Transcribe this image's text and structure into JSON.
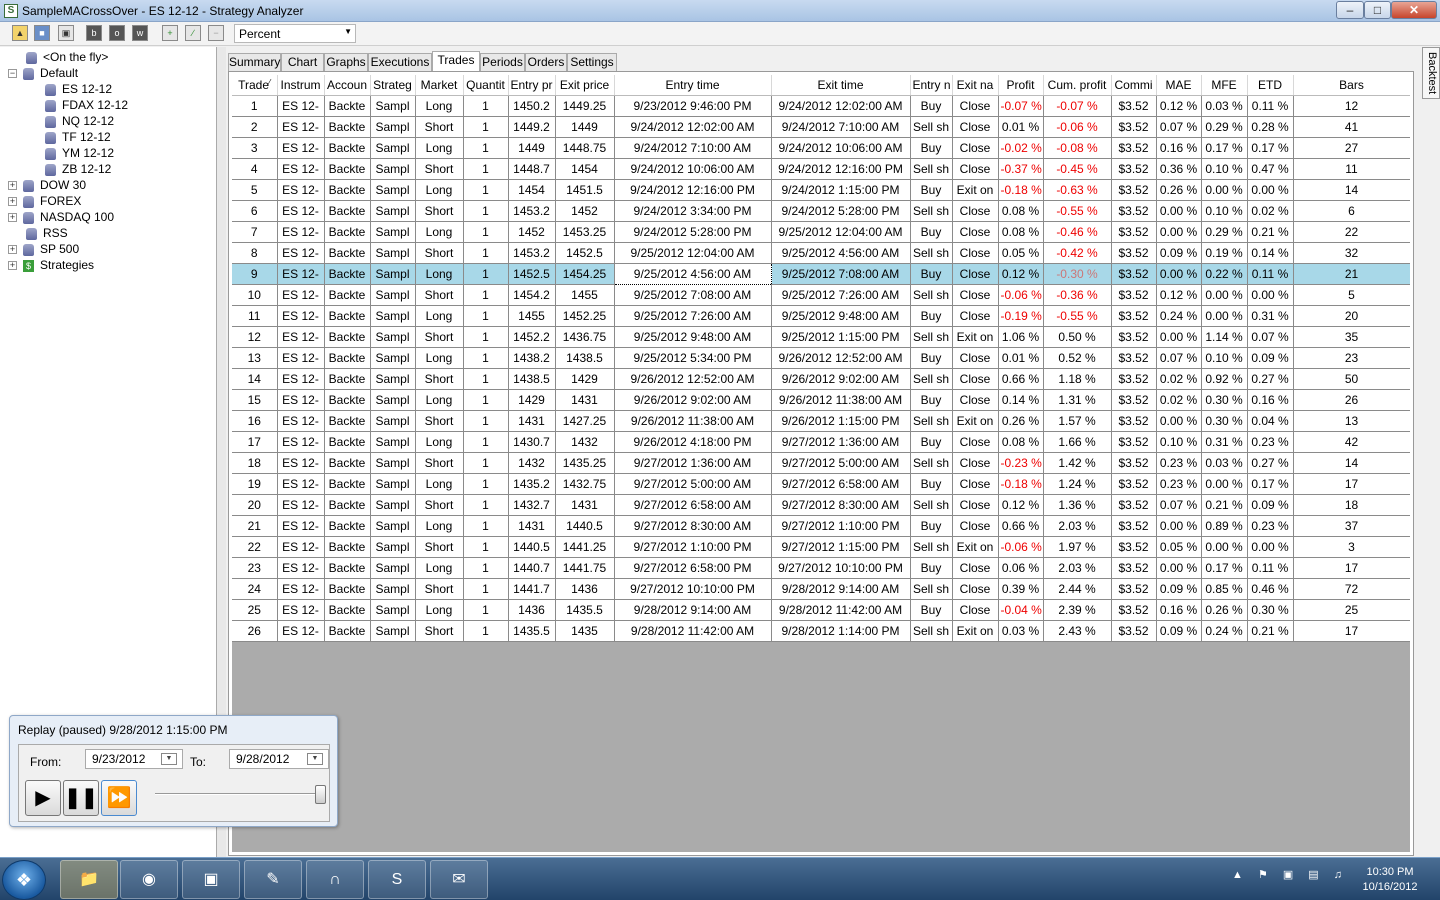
{
  "window": {
    "title": "SampleMACrossOver - ES 12-12 - Strategy Analyzer",
    "app_icon": "S"
  },
  "toolbar": {
    "percent_value": "Percent",
    "btn_b": "b",
    "btn_o": "o",
    "btn_w": "w"
  },
  "tree": {
    "on_the_fly": "<On the fly>",
    "default": "Default",
    "default_children": [
      "ES 12-12",
      "FDAX 12-12",
      "NQ 12-12",
      "TF 12-12",
      "YM 12-12",
      "ZB 12-12"
    ],
    "dow30": "DOW 30",
    "forex": "FOREX",
    "nasdaq": "NASDAQ 100",
    "rss": "RSS",
    "sp500": "SP 500",
    "strategies": "Strategies"
  },
  "tabs": [
    "Summary",
    "Chart",
    "Graphs",
    "Executions",
    "Trades",
    "Periods",
    "Orders",
    "Settings"
  ],
  "right_tab": "Backtest",
  "columns": [
    "Trade",
    "Instrum",
    "Accoun",
    "Strateg",
    "Market",
    "Quantit",
    "Entry pr",
    "Exit price",
    "Entry time",
    "Exit time",
    "Entry n",
    "Exit na",
    "Profit",
    "Cum. profit",
    "Commi",
    "MAE",
    "MFE",
    "ETD",
    "Bars"
  ],
  "sort_indicator": "⁄",
  "trades": [
    [
      "1",
      "ES 12-",
      "Backte",
      "Sampl",
      "Long",
      "1",
      "1450.2",
      "1449.25",
      "9/23/2012 9:46:00 PM",
      "9/24/2012 12:02:00 AM",
      "Buy",
      "Close",
      "-0.07 %",
      "-0.07 %",
      "$3.52",
      "0.12 %",
      "0.03 %",
      "0.11 %",
      "12"
    ],
    [
      "2",
      "ES 12-",
      "Backte",
      "Sampl",
      "Short",
      "1",
      "1449.2",
      "1449",
      "9/24/2012 12:02:00 AM",
      "9/24/2012 7:10:00 AM",
      "Sell sh",
      "Close",
      "0.01 %",
      "-0.06 %",
      "$3.52",
      "0.07 %",
      "0.29 %",
      "0.28 %",
      "41"
    ],
    [
      "3",
      "ES 12-",
      "Backte",
      "Sampl",
      "Long",
      "1",
      "1449",
      "1448.75",
      "9/24/2012 7:10:00 AM",
      "9/24/2012 10:06:00 AM",
      "Buy",
      "Close",
      "-0.02 %",
      "-0.08 %",
      "$3.52",
      "0.16 %",
      "0.17 %",
      "0.17 %",
      "27"
    ],
    [
      "4",
      "ES 12-",
      "Backte",
      "Sampl",
      "Short",
      "1",
      "1448.7",
      "1454",
      "9/24/2012 10:06:00 AM",
      "9/24/2012 12:16:00 PM",
      "Sell sh",
      "Close",
      "-0.37 %",
      "-0.45 %",
      "$3.52",
      "0.36 %",
      "0.10 %",
      "0.47 %",
      "11"
    ],
    [
      "5",
      "ES 12-",
      "Backte",
      "Sampl",
      "Long",
      "1",
      "1454",
      "1451.5",
      "9/24/2012 12:16:00 PM",
      "9/24/2012 1:15:00 PM",
      "Buy",
      "Exit on",
      "-0.18 %",
      "-0.63 %",
      "$3.52",
      "0.26 %",
      "0.00 %",
      "0.00 %",
      "14"
    ],
    [
      "6",
      "ES 12-",
      "Backte",
      "Sampl",
      "Short",
      "1",
      "1453.2",
      "1452",
      "9/24/2012 3:34:00 PM",
      "9/24/2012 5:28:00 PM",
      "Sell sh",
      "Close",
      "0.08 %",
      "-0.55 %",
      "$3.52",
      "0.00 %",
      "0.10 %",
      "0.02 %",
      "6"
    ],
    [
      "7",
      "ES 12-",
      "Backte",
      "Sampl",
      "Long",
      "1",
      "1452",
      "1453.25",
      "9/24/2012 5:28:00 PM",
      "9/25/2012 12:04:00 AM",
      "Buy",
      "Close",
      "0.08 %",
      "-0.46 %",
      "$3.52",
      "0.00 %",
      "0.29 %",
      "0.21 %",
      "22"
    ],
    [
      "8",
      "ES 12-",
      "Backte",
      "Sampl",
      "Short",
      "1",
      "1453.2",
      "1452.5",
      "9/25/2012 12:04:00 AM",
      "9/25/2012 4:56:00 AM",
      "Sell sh",
      "Close",
      "0.05 %",
      "-0.42 %",
      "$3.52",
      "0.09 %",
      "0.19 %",
      "0.14 %",
      "32"
    ],
    [
      "9",
      "ES 12-",
      "Backte",
      "Sampl",
      "Long",
      "1",
      "1452.5",
      "1454.25",
      "9/25/2012 4:56:00 AM",
      "9/25/2012 7:08:00 AM",
      "Buy",
      "Close",
      "0.12 %",
      "-0.30 %",
      "$3.52",
      "0.00 %",
      "0.22 %",
      "0.11 %",
      "21"
    ],
    [
      "10",
      "ES 12-",
      "Backte",
      "Sampl",
      "Short",
      "1",
      "1454.2",
      "1455",
      "9/25/2012 7:08:00 AM",
      "9/25/2012 7:26:00 AM",
      "Sell sh",
      "Close",
      "-0.06 %",
      "-0.36 %",
      "$3.52",
      "0.12 %",
      "0.00 %",
      "0.00 %",
      "5"
    ],
    [
      "11",
      "ES 12-",
      "Backte",
      "Sampl",
      "Long",
      "1",
      "1455",
      "1452.25",
      "9/25/2012 7:26:00 AM",
      "9/25/2012 9:48:00 AM",
      "Buy",
      "Close",
      "-0.19 %",
      "-0.55 %",
      "$3.52",
      "0.24 %",
      "0.00 %",
      "0.31 %",
      "20"
    ],
    [
      "12",
      "ES 12-",
      "Backte",
      "Sampl",
      "Short",
      "1",
      "1452.2",
      "1436.75",
      "9/25/2012 9:48:00 AM",
      "9/25/2012 1:15:00 PM",
      "Sell sh",
      "Exit on",
      "1.06 %",
      "0.50 %",
      "$3.52",
      "0.00 %",
      "1.14 %",
      "0.07 %",
      "35"
    ],
    [
      "13",
      "ES 12-",
      "Backte",
      "Sampl",
      "Long",
      "1",
      "1438.2",
      "1438.5",
      "9/25/2012 5:34:00 PM",
      "9/26/2012 12:52:00 AM",
      "Buy",
      "Close",
      "0.01 %",
      "0.52 %",
      "$3.52",
      "0.07 %",
      "0.10 %",
      "0.09 %",
      "23"
    ],
    [
      "14",
      "ES 12-",
      "Backte",
      "Sampl",
      "Short",
      "1",
      "1438.5",
      "1429",
      "9/26/2012 12:52:00 AM",
      "9/26/2012 9:02:00 AM",
      "Sell sh",
      "Close",
      "0.66 %",
      "1.18 %",
      "$3.52",
      "0.02 %",
      "0.92 %",
      "0.27 %",
      "50"
    ],
    [
      "15",
      "ES 12-",
      "Backte",
      "Sampl",
      "Long",
      "1",
      "1429",
      "1431",
      "9/26/2012 9:02:00 AM",
      "9/26/2012 11:38:00 AM",
      "Buy",
      "Close",
      "0.14 %",
      "1.31 %",
      "$3.52",
      "0.02 %",
      "0.30 %",
      "0.16 %",
      "26"
    ],
    [
      "16",
      "ES 12-",
      "Backte",
      "Sampl",
      "Short",
      "1",
      "1431",
      "1427.25",
      "9/26/2012 11:38:00 AM",
      "9/26/2012 1:15:00 PM",
      "Sell sh",
      "Exit on",
      "0.26 %",
      "1.57 %",
      "$3.52",
      "0.00 %",
      "0.30 %",
      "0.04 %",
      "13"
    ],
    [
      "17",
      "ES 12-",
      "Backte",
      "Sampl",
      "Long",
      "1",
      "1430.7",
      "1432",
      "9/26/2012 4:18:00 PM",
      "9/27/2012 1:36:00 AM",
      "Buy",
      "Close",
      "0.08 %",
      "1.66 %",
      "$3.52",
      "0.10 %",
      "0.31 %",
      "0.23 %",
      "42"
    ],
    [
      "18",
      "ES 12-",
      "Backte",
      "Sampl",
      "Short",
      "1",
      "1432",
      "1435.25",
      "9/27/2012 1:36:00 AM",
      "9/27/2012 5:00:00 AM",
      "Sell sh",
      "Close",
      "-0.23 %",
      "1.42 %",
      "$3.52",
      "0.23 %",
      "0.03 %",
      "0.27 %",
      "14"
    ],
    [
      "19",
      "ES 12-",
      "Backte",
      "Sampl",
      "Long",
      "1",
      "1435.2",
      "1432.75",
      "9/27/2012 5:00:00 AM",
      "9/27/2012 6:58:00 AM",
      "Buy",
      "Close",
      "-0.18 %",
      "1.24 %",
      "$3.52",
      "0.23 %",
      "0.00 %",
      "0.17 %",
      "17"
    ],
    [
      "20",
      "ES 12-",
      "Backte",
      "Sampl",
      "Short",
      "1",
      "1432.7",
      "1431",
      "9/27/2012 6:58:00 AM",
      "9/27/2012 8:30:00 AM",
      "Sell sh",
      "Close",
      "0.12 %",
      "1.36 %",
      "$3.52",
      "0.07 %",
      "0.21 %",
      "0.09 %",
      "18"
    ],
    [
      "21",
      "ES 12-",
      "Backte",
      "Sampl",
      "Long",
      "1",
      "1431",
      "1440.5",
      "9/27/2012 8:30:00 AM",
      "9/27/2012 1:10:00 PM",
      "Buy",
      "Close",
      "0.66 %",
      "2.03 %",
      "$3.52",
      "0.00 %",
      "0.89 %",
      "0.23 %",
      "37"
    ],
    [
      "22",
      "ES 12-",
      "Backte",
      "Sampl",
      "Short",
      "1",
      "1440.5",
      "1441.25",
      "9/27/2012 1:10:00 PM",
      "9/27/2012 1:15:00 PM",
      "Sell sh",
      "Exit on",
      "-0.06 %",
      "1.97 %",
      "$3.52",
      "0.05 %",
      "0.00 %",
      "0.00 %",
      "3"
    ],
    [
      "23",
      "ES 12-",
      "Backte",
      "Sampl",
      "Long",
      "1",
      "1440.7",
      "1441.75",
      "9/27/2012 6:58:00 PM",
      "9/27/2012 10:10:00 PM",
      "Buy",
      "Close",
      "0.06 %",
      "2.03 %",
      "$3.52",
      "0.00 %",
      "0.17 %",
      "0.11 %",
      "17"
    ],
    [
      "24",
      "ES 12-",
      "Backte",
      "Sampl",
      "Short",
      "1",
      "1441.7",
      "1436",
      "9/27/2012 10:10:00 PM",
      "9/28/2012 9:14:00 AM",
      "Sell sh",
      "Close",
      "0.39 %",
      "2.44 %",
      "$3.52",
      "0.09 %",
      "0.85 %",
      "0.46 %",
      "72"
    ],
    [
      "25",
      "ES 12-",
      "Backte",
      "Sampl",
      "Long",
      "1",
      "1436",
      "1435.5",
      "9/28/2012 9:14:00 AM",
      "9/28/2012 11:42:00 AM",
      "Buy",
      "Close",
      "-0.04 %",
      "2.39 %",
      "$3.52",
      "0.16 %",
      "0.26 %",
      "0.30 %",
      "25"
    ],
    [
      "26",
      "ES 12-",
      "Backte",
      "Sampl",
      "Short",
      "1",
      "1435.5",
      "1435",
      "9/28/2012 11:42:00 AM",
      "9/28/2012 1:14:00 PM",
      "Sell sh",
      "Exit on",
      "0.03 %",
      "2.43 %",
      "$3.52",
      "0.09 %",
      "0.24 %",
      "0.21 %",
      "17"
    ]
  ],
  "selected_row": 9,
  "replay": {
    "title": "Replay (paused) 9/28/2012 1:15:00 PM",
    "from_label": "From:",
    "from_value": "9/23/2012",
    "to_label": "To:",
    "to_value": "9/28/2012",
    "speed_level": 1.0
  },
  "taskbar": {
    "time": "10:30 PM",
    "date": "10/16/2012"
  },
  "colors": {
    "negative": "#ee0000",
    "selected_row": "#a8d8e8",
    "grid_empty": "#ababab"
  }
}
